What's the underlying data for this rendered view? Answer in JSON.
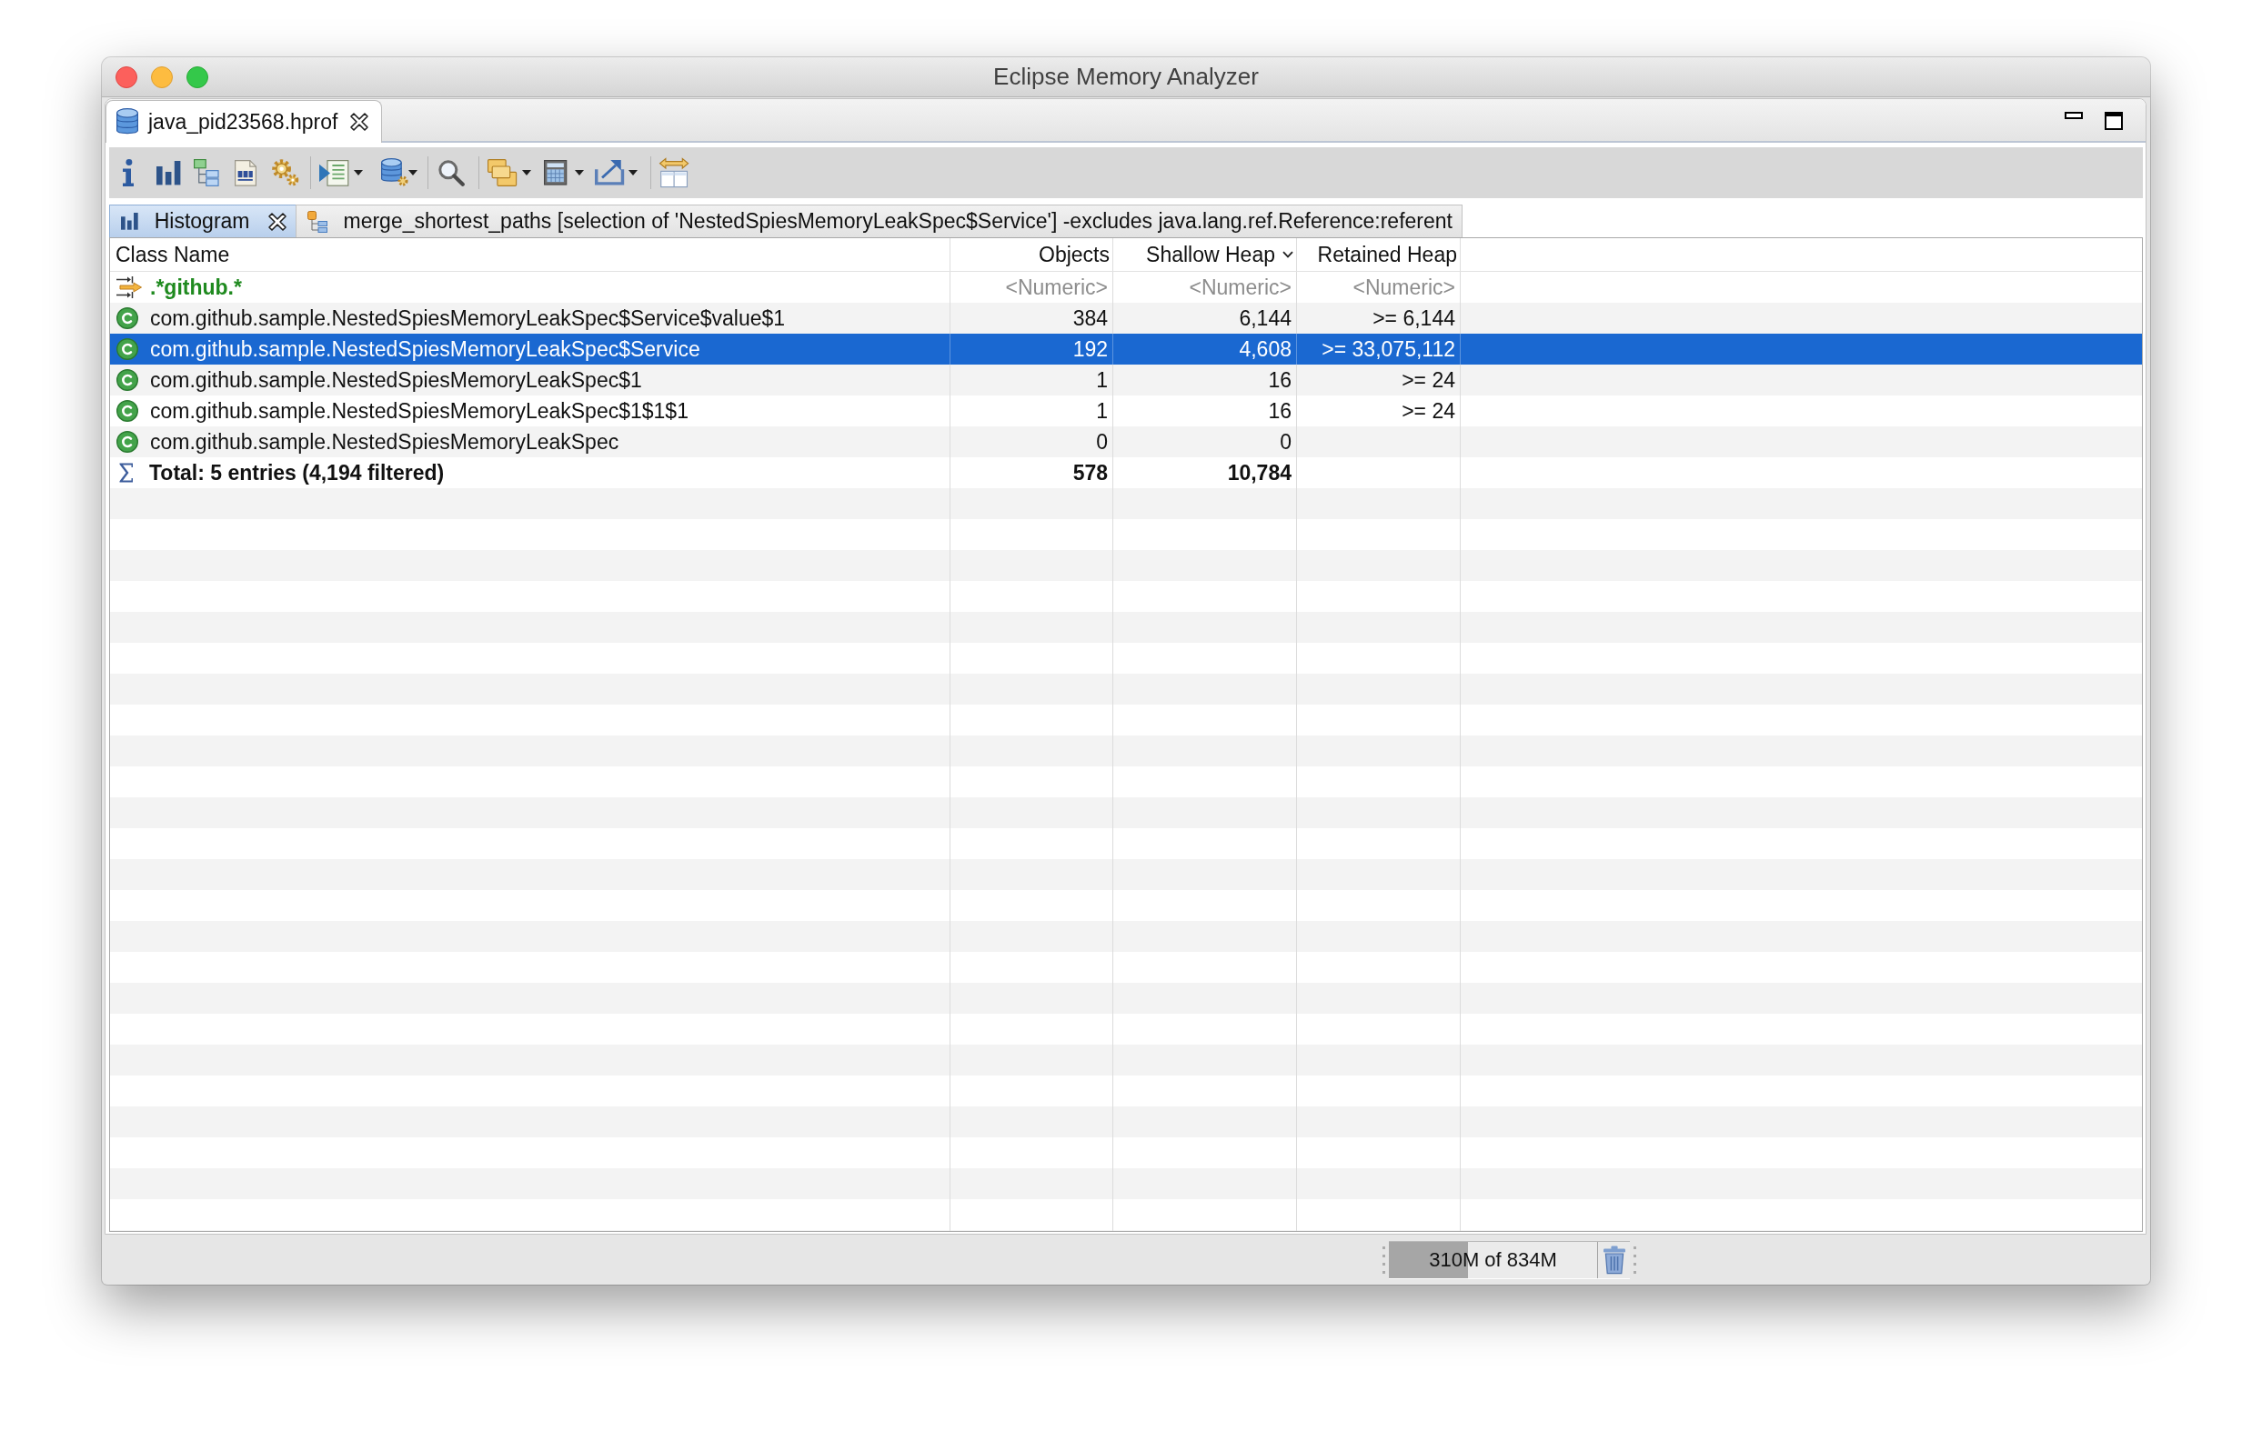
{
  "window": {
    "title": "Eclipse Memory Analyzer"
  },
  "editor_tabs": [
    {
      "label": "java_pid23568.hprof",
      "selected": true
    }
  ],
  "view_tabs": [
    {
      "kind": "histogram",
      "label": "Histogram",
      "selected": true
    },
    {
      "kind": "query",
      "label": "merge_shortest_paths [selection of 'NestedSpiesMemoryLeakSpec$Service'] -excludes java.lang.ref.Reference:referent",
      "selected": false
    }
  ],
  "table": {
    "columns": [
      {
        "label": "Class Name",
        "sorted": false
      },
      {
        "label": "Objects",
        "sorted": false
      },
      {
        "label": "Shallow Heap",
        "sorted": true
      },
      {
        "label": "Retained Heap",
        "sorted": false
      }
    ],
    "filter": [
      {
        "value": ".*github.*"
      },
      {
        "placeholder": "<Numeric>"
      },
      {
        "placeholder": "<Numeric>"
      },
      {
        "placeholder": "<Numeric>"
      }
    ],
    "rows": [
      {
        "class_name": "com.github.sample.NestedSpiesMemoryLeakSpec$Service$value$1",
        "objects": "384",
        "shallow_heap": "6,144",
        "retained_heap": ">= 6,144",
        "selected": false
      },
      {
        "class_name": "com.github.sample.NestedSpiesMemoryLeakSpec$Service",
        "objects": "192",
        "shallow_heap": "4,608",
        "retained_heap": ">= 33,075,112",
        "selected": true
      },
      {
        "class_name": "com.github.sample.NestedSpiesMemoryLeakSpec$1",
        "objects": "1",
        "shallow_heap": "16",
        "retained_heap": ">= 24",
        "selected": false
      },
      {
        "class_name": "com.github.sample.NestedSpiesMemoryLeakSpec$1$1$1",
        "objects": "1",
        "shallow_heap": "16",
        "retained_heap": ">= 24",
        "selected": false
      },
      {
        "class_name": "com.github.sample.NestedSpiesMemoryLeakSpec",
        "objects": "0",
        "shallow_heap": "0",
        "selected": false
      }
    ],
    "total": {
      "label": "Total: 5 entries (4,194 filtered)",
      "objects": "578",
      "shallow_heap": "10,784"
    }
  },
  "status_bar": {
    "heap": {
      "text": "310M of 834M",
      "level": 0.38
    }
  }
}
